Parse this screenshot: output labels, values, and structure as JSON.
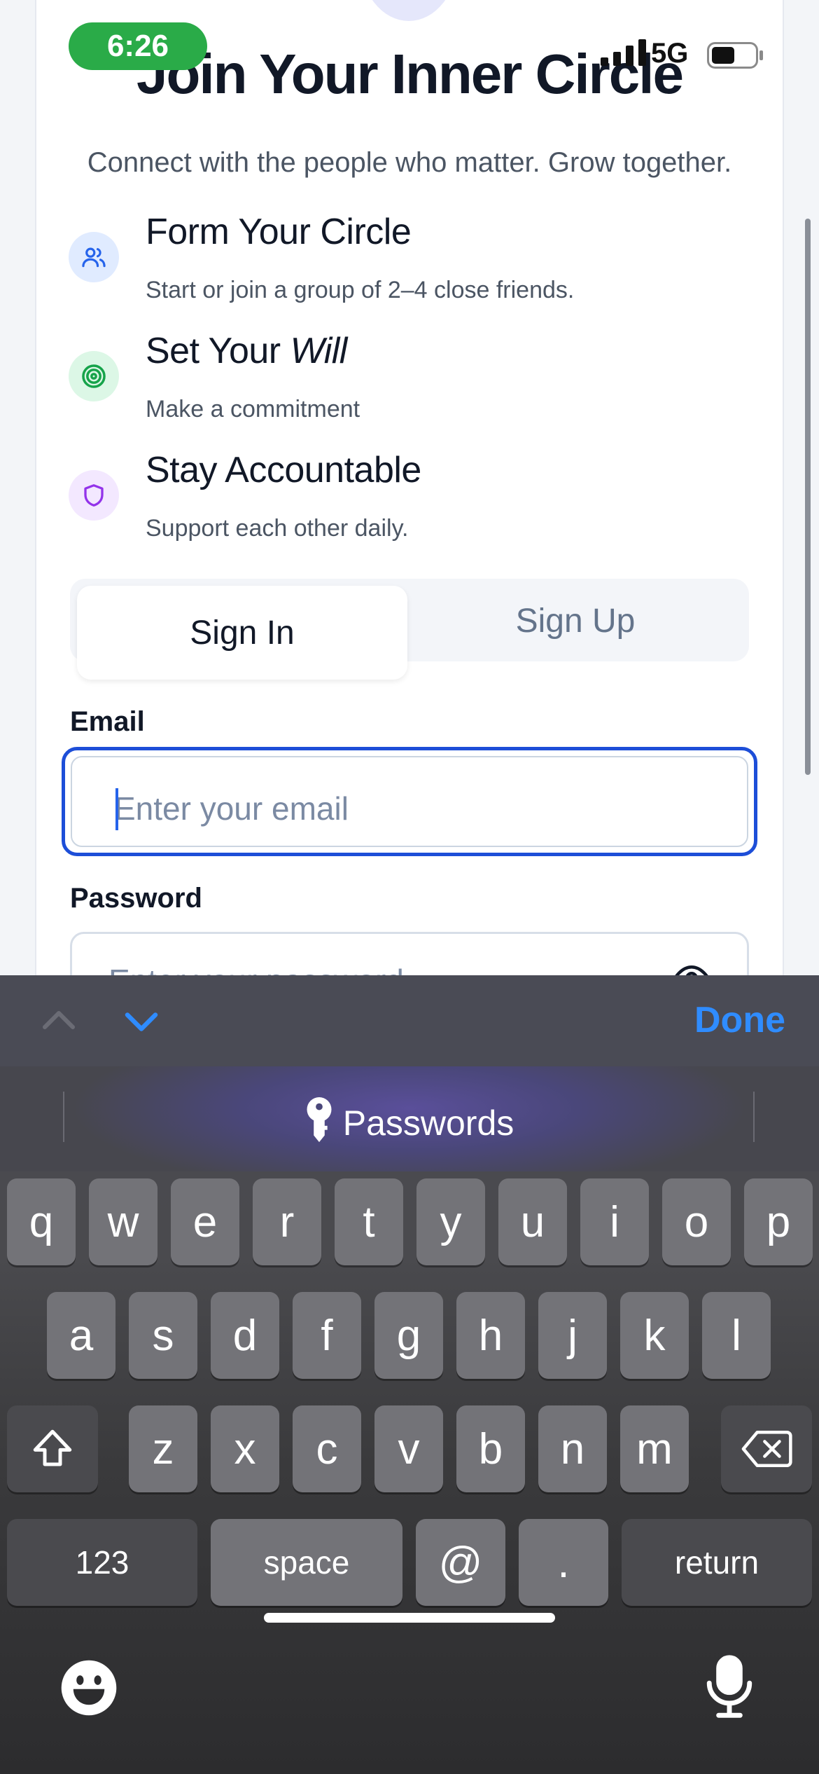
{
  "status_bar": {
    "time": "6:26",
    "network": "5G"
  },
  "header": {
    "title": "Join Your Inner Circle",
    "subtitle": "Connect with the people who matter. Grow together."
  },
  "features": [
    {
      "title": "Form Your Circle",
      "description": "Start or join a group of 2–4 close friends.",
      "icon": "users-icon",
      "color": "#2563eb",
      "bg": "#e0ebff"
    },
    {
      "title_prefix": "Set Your ",
      "title_emphasis": "Will",
      "description": "Make a commitment",
      "icon": "target-icon",
      "color": "#16a34a",
      "bg": "#dcf7e6"
    },
    {
      "title": "Stay Accountable",
      "description": "Support each other daily.",
      "icon": "shield-icon",
      "color": "#9333ea",
      "bg": "#f3e8ff"
    }
  ],
  "auth_tabs": {
    "sign_in": "Sign In",
    "sign_up": "Sign Up",
    "active": "sign_in"
  },
  "form": {
    "email_label": "Email",
    "email_placeholder": "Enter your email",
    "password_label": "Password",
    "password_placeholder": "Enter your password"
  },
  "keyboard": {
    "done": "Done",
    "suggestion": "Passwords",
    "row1": [
      "q",
      "w",
      "e",
      "r",
      "t",
      "y",
      "u",
      "i",
      "o",
      "p"
    ],
    "row2": [
      "a",
      "s",
      "d",
      "f",
      "g",
      "h",
      "j",
      "k",
      "l"
    ],
    "row3": [
      "z",
      "x",
      "c",
      "v",
      "b",
      "n",
      "m"
    ],
    "numbers_key": "123",
    "space_key": "space",
    "at_key": "@",
    "dot_key": ".",
    "return_key": "return"
  }
}
